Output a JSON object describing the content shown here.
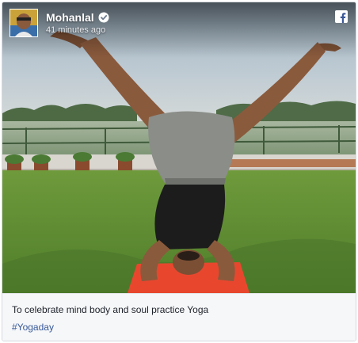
{
  "post": {
    "author": "Mohanlal",
    "verified": true,
    "timestamp": "41 minutes ago",
    "platform_icon": "facebook-icon",
    "caption": "To celebrate mind body and soul practice Yoga",
    "hashtag": "#Yogaday"
  },
  "colors": {
    "link": "#365899",
    "text": "#1d2129",
    "card_bg": "#f6f7f9",
    "mat": "#e8472e"
  }
}
